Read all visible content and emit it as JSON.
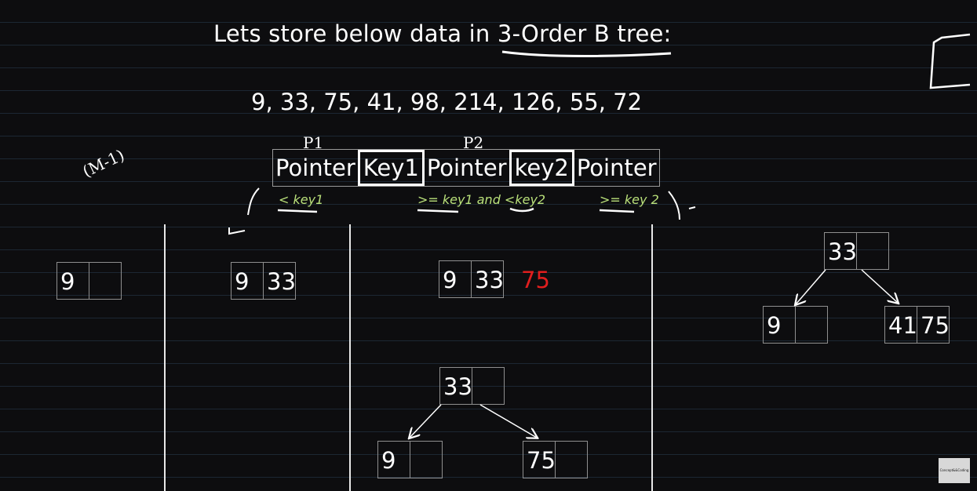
{
  "title": {
    "text": "Lets store below data in 3-Order B tree:"
  },
  "sequence": {
    "text": "9, 33, 75, 41, 98, 214, 126, 55, 72"
  },
  "annotations": {
    "p1": "P1",
    "p2": "P2",
    "order_note": "(M-1)"
  },
  "node_structure": {
    "cells": [
      "Pointer",
      "Key1",
      "Pointer",
      "key2",
      "Pointer"
    ],
    "rules": [
      "< key1",
      ">= key1 and <key2",
      ">= key 2"
    ]
  },
  "steps": {
    "step1": {
      "keys": [
        "9",
        ""
      ]
    },
    "step2": {
      "keys": [
        "9",
        "33"
      ]
    },
    "step3": {
      "keys": [
        "9",
        "33"
      ],
      "overflow": "75",
      "split_root": [
        "33",
        ""
      ],
      "split_left": [
        "9",
        ""
      ],
      "split_right": [
        "75",
        ""
      ]
    },
    "step4": {
      "root": [
        "33",
        ""
      ],
      "left": [
        "9",
        ""
      ],
      "right": [
        "41",
        "75"
      ]
    }
  },
  "watermark": {
    "text": "Concept&&Coding"
  },
  "colors": {
    "background": "#0d0d0f",
    "highlight": "#e01e1e",
    "rule_text": "#b9e07a"
  }
}
